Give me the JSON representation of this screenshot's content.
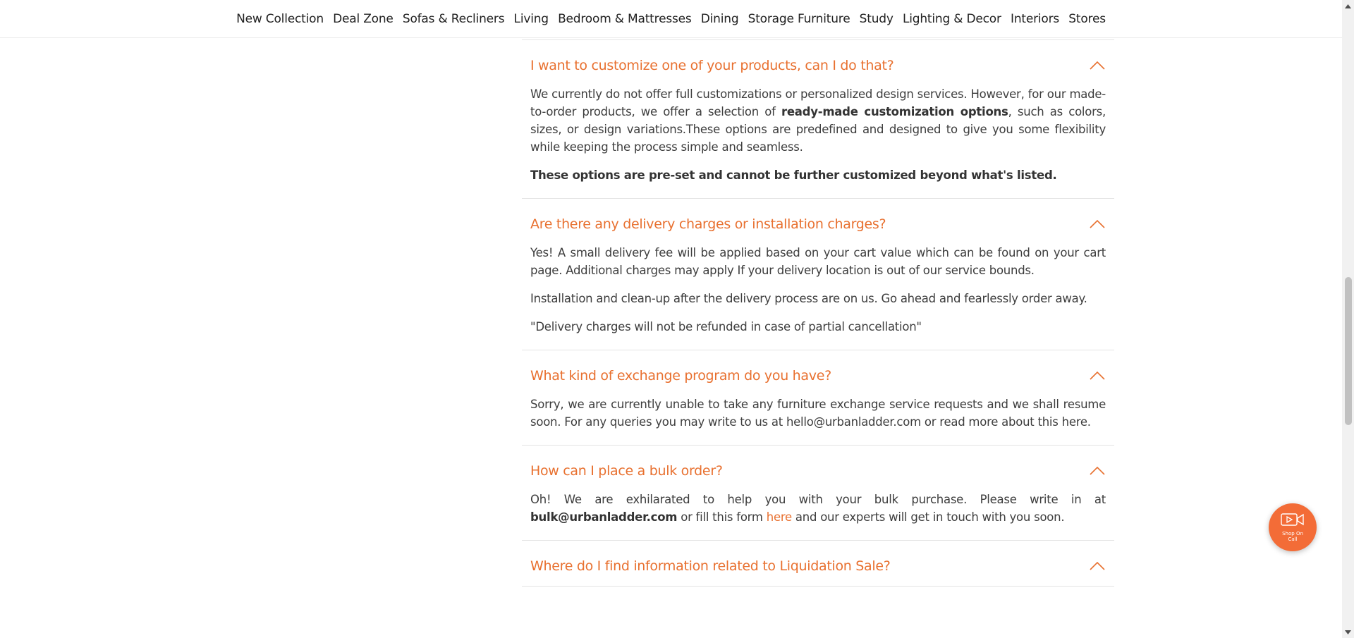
{
  "nav": {
    "items": [
      "New Collection",
      "Deal Zone",
      "Sofas & Recliners",
      "Living",
      "Bedroom & Mattresses",
      "Dining",
      "Storage Furniture",
      "Study",
      "Lighting & Decor",
      "Interiors",
      "Stores"
    ]
  },
  "faq": {
    "accent_color": "#e8702f",
    "items": [
      {
        "question": "I want to customize one of your products, can I do that?",
        "p1_a": "We currently do not offer full customizations or personalized design services. However, for our made-to-order products, we offer a selection of ",
        "p1_b": "ready-made customization options",
        "p1_c": ", such as colors, sizes, or design variations.These options are predefined and designed to give you some flexibility while keeping the process simple and seamless.",
        "p2": "These options are pre-set and cannot be further customized beyond what's listed."
      },
      {
        "question": "Are there any delivery charges or installation charges?",
        "p1": "Yes! A small delivery fee will be applied based on your cart value which can be found on your cart page. Additional charges may apply If your delivery location is out of our service bounds.",
        "p2": "Installation and clean-up after the delivery process are on us. Go ahead and fearlessly order away.",
        "p3": "\"Delivery charges will not be refunded in case of partial cancellation\""
      },
      {
        "question": "What kind of exchange program do you have?",
        "p1": "Sorry, we are currently unable to take any furniture exchange service requests and we shall resume soon. For any queries you may write to us at hello@urbanladder.com or read more about this here."
      },
      {
        "question": "How can I place a bulk order?",
        "p1_a": "Oh! We are exhilarated to help you with your bulk purchase. Please write in at ",
        "p1_b": "bulk@urbanladder.com",
        "p1_c": " or fill this form ",
        "p1_link": "here",
        "p1_d": " and our experts will get in touch with you soon."
      },
      {
        "question": "Where do I find information related to Liquidation Sale?"
      }
    ]
  },
  "floating_button": {
    "label": "Shop On Call",
    "icon": "video-call-icon"
  }
}
